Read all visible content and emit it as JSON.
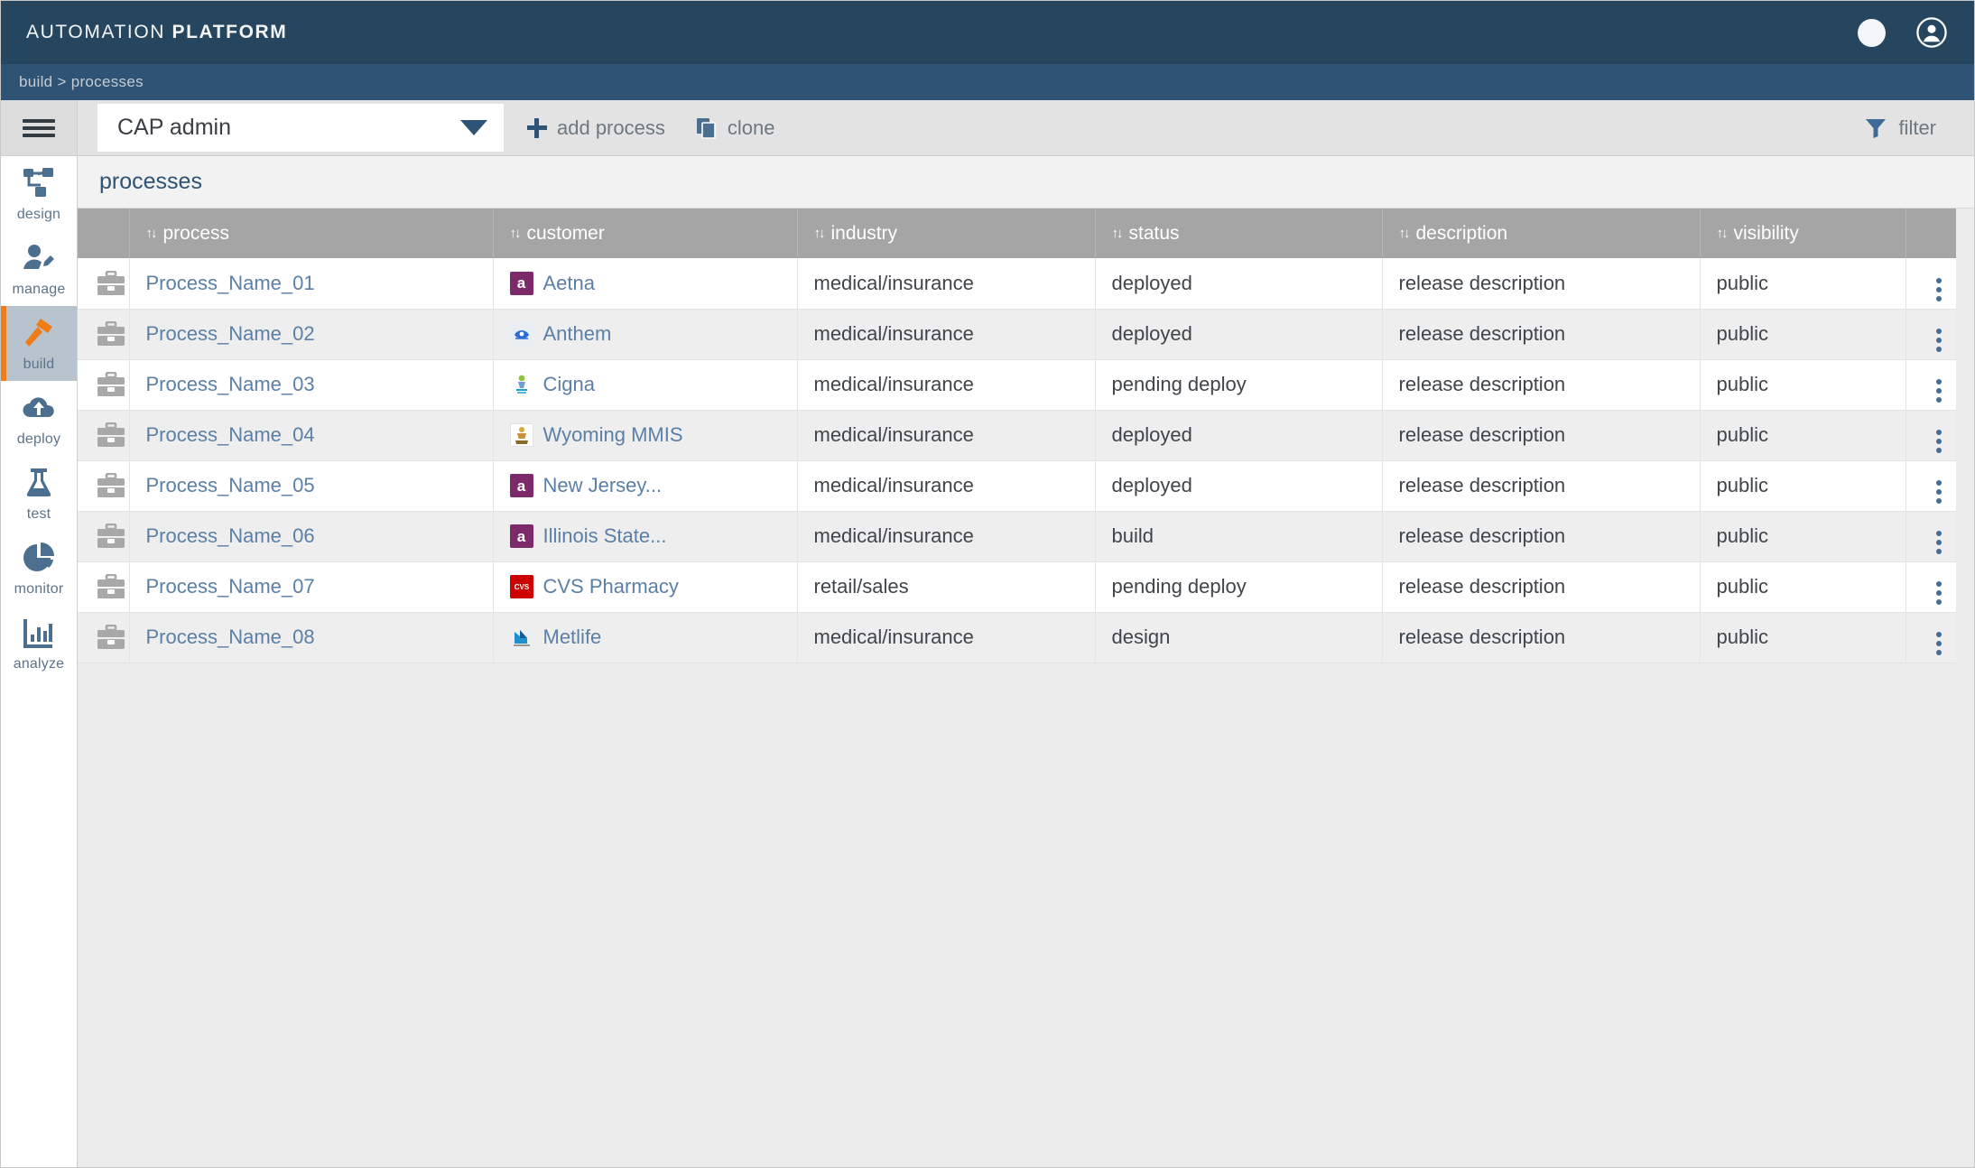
{
  "header": {
    "brand_prefix": "AUTOMATION ",
    "brand_bold": "PLATFORM",
    "notification_icon": "circle-icon",
    "account_icon": "account-icon"
  },
  "breadcrumb": {
    "text": "build > processes"
  },
  "sidebar": {
    "menu_icon": "hamburger-icon",
    "items": [
      {
        "label": "design",
        "icon": "sitemap-icon",
        "active": false
      },
      {
        "label": "manage",
        "icon": "user-edit-icon",
        "active": false
      },
      {
        "label": "build",
        "icon": "hammer-icon",
        "active": true
      },
      {
        "label": "deploy",
        "icon": "cloud-upload-icon",
        "active": false
      },
      {
        "label": "test",
        "icon": "flask-icon",
        "active": false
      },
      {
        "label": "monitor",
        "icon": "pie-chart-icon",
        "active": false
      },
      {
        "label": "analyze",
        "icon": "bar-chart-icon",
        "active": false
      }
    ]
  },
  "toolbar": {
    "select_value": "CAP admin",
    "select_caret_icon": "chevron-down-icon",
    "add_process_label": "add process",
    "add_process_icon": "plus-icon",
    "clone_label": "clone",
    "clone_icon": "copy-icon",
    "filter_label": "filter",
    "filter_icon": "funnel-icon"
  },
  "panel": {
    "title": "processes"
  },
  "table": {
    "columns": [
      {
        "key": "icon",
        "label": "",
        "sortable": false
      },
      {
        "key": "process",
        "label": "process",
        "sortable": true
      },
      {
        "key": "customer",
        "label": "customer",
        "sortable": true
      },
      {
        "key": "industry",
        "label": "industry",
        "sortable": true
      },
      {
        "key": "status",
        "label": "status",
        "sortable": true
      },
      {
        "key": "description",
        "label": "description",
        "sortable": true
      },
      {
        "key": "visibility",
        "label": "visibility",
        "sortable": true
      },
      {
        "key": "menu",
        "label": "",
        "sortable": false
      }
    ],
    "sort_icon": "↑↓",
    "row_icon": "briefcase-icon",
    "row_menu_icon": "kebab-menu-icon",
    "rows": [
      {
        "process": "Process_Name_01",
        "customer": "Aetna",
        "logo": "aetna",
        "logo_text": "a",
        "industry": "medical/insurance",
        "status": "deployed",
        "description": "release description",
        "visibility": "public"
      },
      {
        "process": "Process_Name_02",
        "customer": "Anthem",
        "logo": "anthem",
        "logo_text": "",
        "industry": "medical/insurance",
        "status": "deployed",
        "description": "release description",
        "visibility": "public"
      },
      {
        "process": "Process_Name_03",
        "customer": "Cigna",
        "logo": "cigna",
        "logo_text": "",
        "industry": "medical/insurance",
        "status": "pending deploy",
        "description": "release description",
        "visibility": "public"
      },
      {
        "process": "Process_Name_04",
        "customer": "Wyoming MMIS",
        "logo": "wyoming",
        "logo_text": "",
        "industry": "medical/insurance",
        "status": "deployed",
        "description": "release description",
        "visibility": "public"
      },
      {
        "process": "Process_Name_05",
        "customer": "New Jersey...",
        "logo": "aetna",
        "logo_text": "a",
        "industry": "medical/insurance",
        "status": "deployed",
        "description": "release description",
        "visibility": "public"
      },
      {
        "process": "Process_Name_06",
        "customer": "Illinois State...",
        "logo": "aetna",
        "logo_text": "a",
        "industry": "medical/insurance",
        "status": "build",
        "description": "release description",
        "visibility": "public"
      },
      {
        "process": "Process_Name_07",
        "customer": "CVS Pharmacy",
        "logo": "cvs",
        "logo_text": "",
        "industry": "retail/sales",
        "status": "pending deploy",
        "description": "release description",
        "visibility": "public"
      },
      {
        "process": "Process_Name_08",
        "customer": "Metlife",
        "logo": "metlife",
        "logo_text": "",
        "industry": "medical/insurance",
        "status": "design",
        "description": "release description",
        "visibility": "public"
      }
    ]
  },
  "colors": {
    "header_bg": "#26455f",
    "breadcrumb_bg": "#2f5374",
    "accent_orange": "#f07c18",
    "link_blue": "#5b7fa6",
    "table_header_bg": "#a5a5a5"
  }
}
